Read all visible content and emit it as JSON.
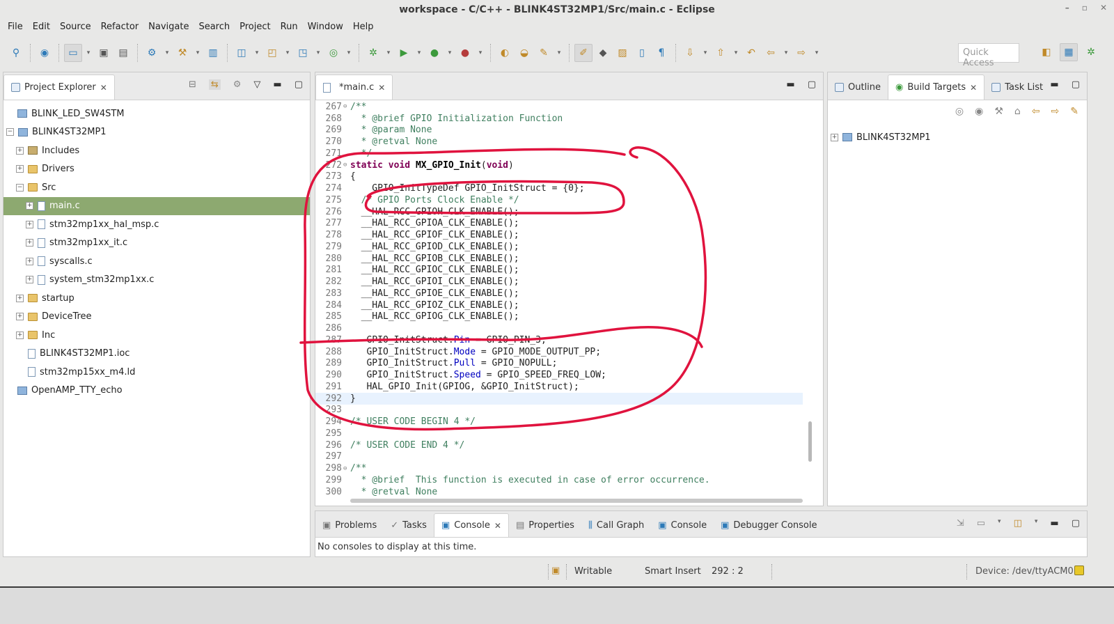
{
  "window": {
    "title": "workspace - C/C++ - BLINK4ST32MP1/Src/main.c - Eclipse",
    "controls": [
      "–",
      "▫",
      "✕"
    ]
  },
  "menubar": [
    "File",
    "Edit",
    "Source",
    "Refactor",
    "Navigate",
    "Search",
    "Project",
    "Run",
    "Window",
    "Help"
  ],
  "toolbar": {
    "quick_access": "Quick Access"
  },
  "project_explorer": {
    "title": "Project Explorer",
    "items": [
      {
        "label": "BLINK_LED_SW4STM",
        "icon": "project-icon"
      },
      {
        "label": "BLINK4ST32MP1",
        "icon": "project-icon"
      },
      {
        "label": "Includes",
        "icon": "includes-icon"
      },
      {
        "label": "Drivers",
        "icon": "folder-icon"
      },
      {
        "label": "Src",
        "icon": "folder-icon"
      },
      {
        "label": "main.c",
        "icon": "c-file-icon"
      },
      {
        "label": "stm32mp1xx_hal_msp.c",
        "icon": "c-file-icon"
      },
      {
        "label": "stm32mp1xx_it.c",
        "icon": "c-file-icon"
      },
      {
        "label": "syscalls.c",
        "icon": "c-file-icon"
      },
      {
        "label": "system_stm32mp1xx.c",
        "icon": "c-file-icon"
      },
      {
        "label": "startup",
        "icon": "folder-icon"
      },
      {
        "label": "DeviceTree",
        "icon": "folder-icon"
      },
      {
        "label": "Inc",
        "icon": "folder-icon"
      },
      {
        "label": "BLINK4ST32MP1.ioc",
        "icon": "file-icon"
      },
      {
        "label": "stm32mp15xx_m4.ld",
        "icon": "file-icon"
      },
      {
        "label": "OpenAMP_TTY_echo",
        "icon": "project-icon"
      }
    ]
  },
  "editor": {
    "tab": "*main.c",
    "lines": [
      {
        "n": "267",
        "t": "/**"
      },
      {
        "n": "268",
        "t": "  * @brief GPIO Initialization Function"
      },
      {
        "n": "269",
        "t": "  * @param None"
      },
      {
        "n": "270",
        "t": "  * @retval None"
      },
      {
        "n": "271",
        "t": "  */"
      },
      {
        "n": "272",
        "t": "static void MX_GPIO_Init(void)"
      },
      {
        "n": "273",
        "t": "{"
      },
      {
        "n": "274",
        "t": "    GPIO_InitTypeDef GPIO_InitStruct = {0};"
      },
      {
        "n": "275",
        "t": "  /* GPIO Ports Clock Enable */"
      },
      {
        "n": "276",
        "t": "  __HAL_RCC_GPIOH_CLK_ENABLE();"
      },
      {
        "n": "277",
        "t": "  __HAL_RCC_GPIOA_CLK_ENABLE();"
      },
      {
        "n": "278",
        "t": "  __HAL_RCC_GPIOF_CLK_ENABLE();"
      },
      {
        "n": "279",
        "t": "  __HAL_RCC_GPIOD_CLK_ENABLE();"
      },
      {
        "n": "280",
        "t": "  __HAL_RCC_GPIOB_CLK_ENABLE();"
      },
      {
        "n": "281",
        "t": "  __HAL_RCC_GPIOC_CLK_ENABLE();"
      },
      {
        "n": "282",
        "t": "  __HAL_RCC_GPIOI_CLK_ENABLE();"
      },
      {
        "n": "283",
        "t": "  __HAL_RCC_GPIOE_CLK_ENABLE();"
      },
      {
        "n": "284",
        "t": "  __HAL_RCC_GPIOZ_CLK_ENABLE();"
      },
      {
        "n": "285",
        "t": "  __HAL_RCC_GPIOG_CLK_ENABLE();"
      },
      {
        "n": "286",
        "t": ""
      },
      {
        "n": "287",
        "t": "   GPIO_InitStruct.Pin = GPIO_PIN_3;"
      },
      {
        "n": "288",
        "t": "   GPIO_InitStruct.Mode = GPIO_MODE_OUTPUT_PP;"
      },
      {
        "n": "289",
        "t": "   GPIO_InitStruct.Pull = GPIO_NOPULL;"
      },
      {
        "n": "290",
        "t": "   GPIO_InitStruct.Speed = GPIO_SPEED_FREQ_LOW;"
      },
      {
        "n": "291",
        "t": "   HAL_GPIO_Init(GPIOG, &GPIO_InitStruct);"
      },
      {
        "n": "292",
        "t": "}"
      },
      {
        "n": "293",
        "t": ""
      },
      {
        "n": "294",
        "t": "/* USER CODE BEGIN 4 */"
      },
      {
        "n": "295",
        "t": ""
      },
      {
        "n": "296",
        "t": "/* USER CODE END 4 */"
      },
      {
        "n": "297",
        "t": ""
      },
      {
        "n": "298",
        "t": "/**"
      },
      {
        "n": "299",
        "t": "  * @brief  This function is executed in case of error occurrence."
      },
      {
        "n": "300",
        "t": "  * @retval None"
      }
    ]
  },
  "right_panel": {
    "tabs": [
      "Outline",
      "Build Targets",
      "Task List"
    ],
    "tree_item": "BLINK4ST32MP1"
  },
  "bottom_panel": {
    "tabs": [
      "Problems",
      "Tasks",
      "Console",
      "Properties",
      "Call Graph",
      "Console",
      "Debugger Console"
    ],
    "message": "No consoles to display at this time."
  },
  "status": {
    "writable": "Writable",
    "insert_mode": "Smart Insert",
    "position": "292 : 2",
    "device": "Device: /dev/ttyACM0"
  },
  "colors": {
    "selection": "#8da970",
    "annotation": "#e0133e",
    "comment": "#3f7f5f",
    "keyword": "#7f0055",
    "field": "#0000c0"
  }
}
